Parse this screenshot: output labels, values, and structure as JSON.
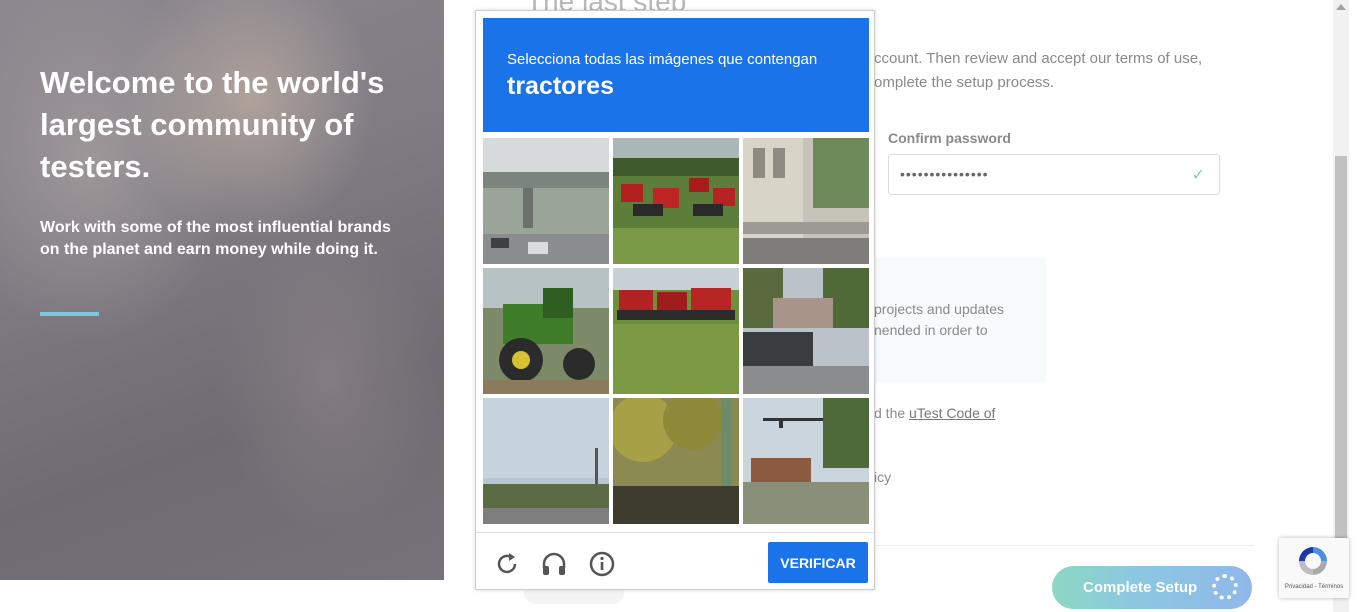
{
  "hero": {
    "title": "Welcome to the world's largest community of testers.",
    "subtitle": "Work with some of the most influential brands on the planet and earn money while doing it."
  },
  "form": {
    "step_title": "The last step",
    "intro": "ccount. Then review and accept our terms of use, omplete the setup process.",
    "confirm_password_label": "Confirm password",
    "confirm_password_value": "•••••••••••••••",
    "info_text": "projects and updates nended in order to",
    "code_prefix": "d the ",
    "code_link": "uTest Code of",
    "policy_text": "icy",
    "complete_setup_label": "Complete Setup"
  },
  "captcha": {
    "instruction": "Selecciona todas las imágenes que contengan",
    "target": "tractores",
    "verify_label": "VERIFICAR",
    "tiles": [
      {
        "name": "tile-overpass"
      },
      {
        "name": "tile-red-tractors-lot"
      },
      {
        "name": "tile-building"
      },
      {
        "name": "tile-green-tractor"
      },
      {
        "name": "tile-red-tractors-field"
      },
      {
        "name": "tile-street-car"
      },
      {
        "name": "tile-road-sky"
      },
      {
        "name": "tile-trees-pole"
      },
      {
        "name": "tile-traffic-light"
      }
    ],
    "icons": [
      "reload-icon",
      "audio-icon",
      "info-icon"
    ]
  },
  "recaptcha_badge": {
    "terms": "Privacidad - Términos"
  },
  "colors": {
    "captcha_blue": "#1a73e8",
    "hero_accent_line": "#7fc8dc",
    "button_gradient_start": "#8cd7c3",
    "button_gradient_end": "#8fb8ea"
  }
}
